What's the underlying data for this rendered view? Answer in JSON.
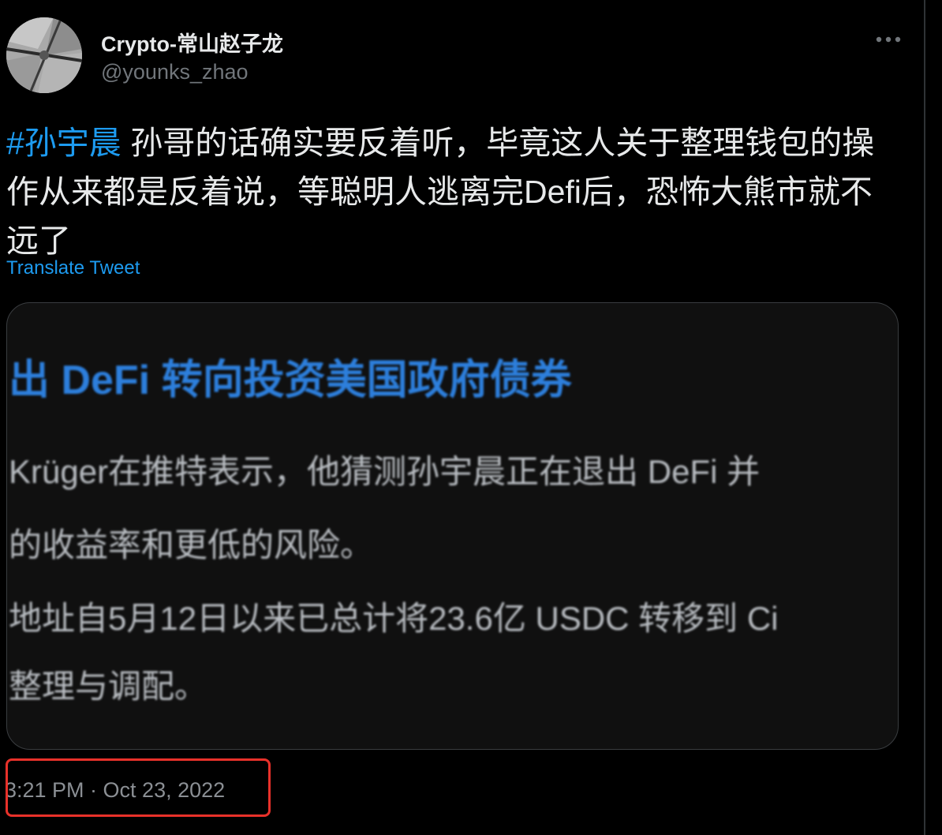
{
  "tweet": {
    "author": {
      "display_name": "Crypto-常山赵子龙",
      "handle": "@younks_zhao"
    },
    "text": {
      "hashtag": "#孙宇晨",
      "body": " 孙哥的话确实要反着听，毕竟这人关于整理钱包的操作从来都是反着说，等聪明人逃离完Defi后，恐怖大熊市就不远了"
    },
    "translate_label": "Translate Tweet",
    "media": {
      "title": "出 DeFi 转向投资美国政府债券",
      "lines": [
        " Krüger在推特表示，他猜测孙宇晨正在退出 DeFi 并",
        "的收益率和更低的风险。",
        "地址自5月12日以来已总计将23.6亿 USDC 转移到 Ci",
        "整理与调配。"
      ]
    },
    "timestamp": "3:21 PM · Oct 23, 2022"
  },
  "icons": {
    "more": "more-horizontal-icon",
    "avatar": "avatar-image"
  },
  "colors": {
    "background": "#000000",
    "text": "#e7e9ea",
    "secondary_text": "#71767b",
    "link": "#1d9bf0",
    "highlight_box": "#e8312a"
  }
}
